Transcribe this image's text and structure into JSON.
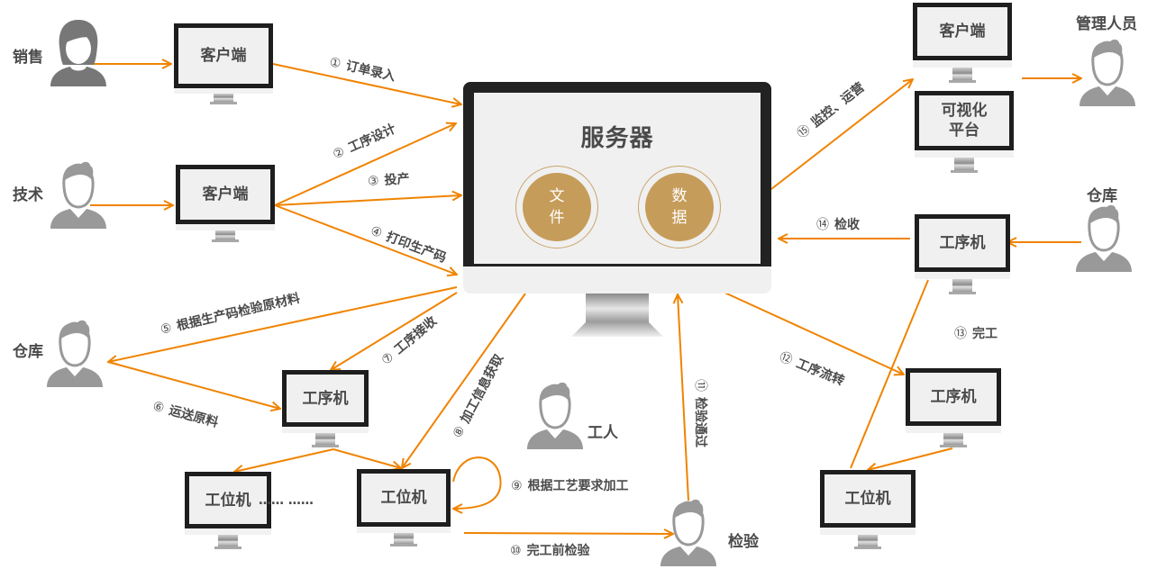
{
  "diagram": {
    "accent_color": "#f08300",
    "server": {
      "title": "服务器",
      "stores": [
        {
          "line1": "文",
          "line2": "件"
        },
        {
          "line1": "数",
          "line2": "据"
        }
      ]
    },
    "roles": {
      "sales": "销售",
      "tech": "技术",
      "warehouse_left": "仓库",
      "worker": "工人",
      "inspector": "检验",
      "manager": "管理人员",
      "warehouse_right": "仓库"
    },
    "terminals": {
      "client_sales": "客户端",
      "client_tech": "客户端",
      "process_left": "工序机",
      "station_left_a": "工位机",
      "station_left_b": "工位机",
      "ellipsis": "…… ……",
      "client_mgmt": "客户端",
      "visual_line1": "可视化",
      "visual_line2": "平台",
      "process_right_top": "工序机",
      "process_right_mid": "工序机",
      "station_right": "工位机"
    },
    "steps": [
      {
        "num": "①",
        "label": "订单录入"
      },
      {
        "num": "②",
        "label": "工序设计"
      },
      {
        "num": "③",
        "label": "投产"
      },
      {
        "num": "④",
        "label": "打印生产码"
      },
      {
        "num": "⑤",
        "label": "根据生产码检验原材料"
      },
      {
        "num": "⑥",
        "label": "运送原料"
      },
      {
        "num": "⑦",
        "label": "工序接收"
      },
      {
        "num": "⑧",
        "label": "加工信息获取"
      },
      {
        "num": "⑨",
        "label": "根据工艺要求加工"
      },
      {
        "num": "⑩",
        "label": "完工前检验"
      },
      {
        "num": "⑪",
        "label": "检验通过"
      },
      {
        "num": "⑫",
        "label": "工序流转"
      },
      {
        "num": "⑬",
        "label": "完工"
      },
      {
        "num": "⑭",
        "label": "检收"
      },
      {
        "num": "⑮",
        "label": "监控、运营"
      }
    ]
  }
}
